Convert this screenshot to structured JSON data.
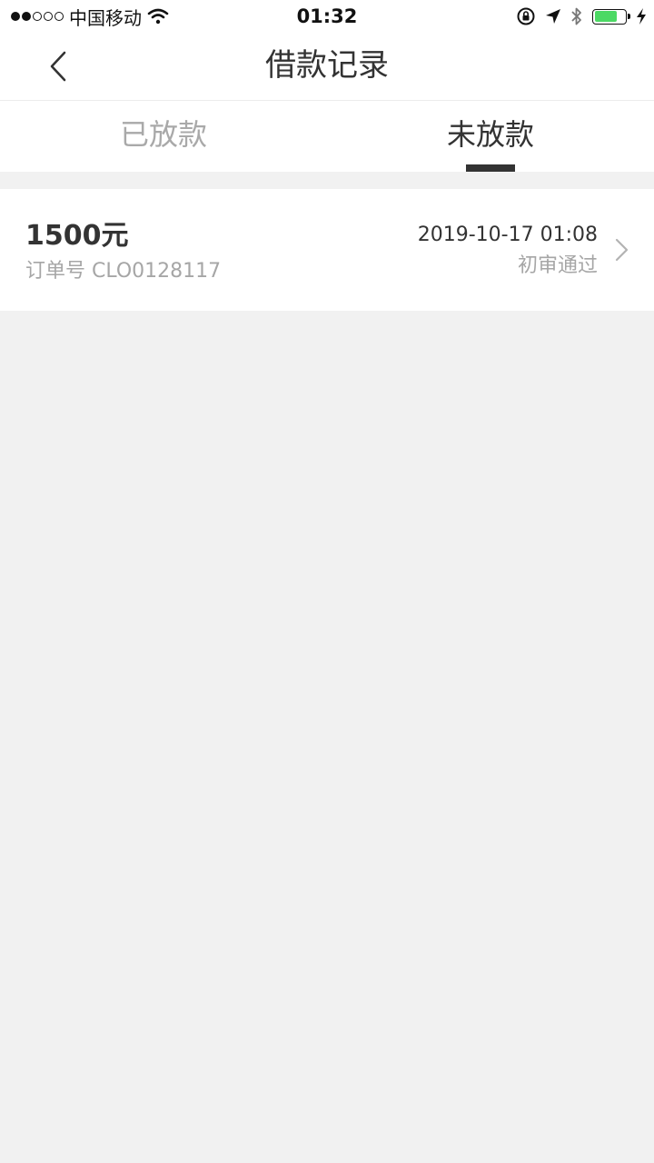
{
  "status_bar": {
    "carrier": "中国移动",
    "time": "01:32",
    "signal_dots_filled": 2,
    "signal_dots_total": 5,
    "battery_level": 0.75,
    "icons": [
      "wifi-icon",
      "rotation-lock-icon",
      "location-arrow-icon",
      "bluetooth-icon",
      "battery-icon",
      "charging-bolt-icon"
    ]
  },
  "nav": {
    "title": "借款记录",
    "back_icon": "chevron-left-icon"
  },
  "tabs": [
    {
      "label": "已放款",
      "active": false
    },
    {
      "label": "未放款",
      "active": true
    }
  ],
  "records": [
    {
      "amount": "1500元",
      "order_number": "订单号 CLO0128117",
      "datetime": "2019-10-17 01:08",
      "status": "初审通过"
    }
  ],
  "colors": {
    "background": "#f1f1f1",
    "text_primary": "#333333",
    "text_secondary": "#a6a6a6",
    "tab_indicator": "#333333",
    "battery_fill": "#4cd964"
  }
}
